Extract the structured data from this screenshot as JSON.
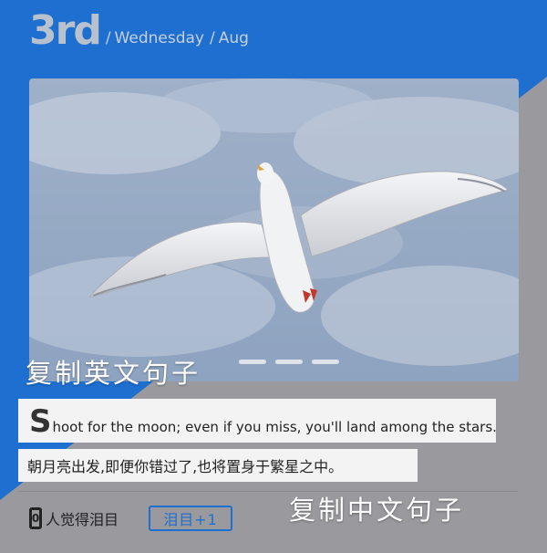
{
  "header": {
    "day": "3rd",
    "sep1": "/",
    "weekday": "Wednesday",
    "sep2": "/",
    "month": "Aug"
  },
  "photo": {
    "subject": "seagull-flying-cloudy-sky"
  },
  "carousel": {
    "page_count": 3
  },
  "overlays": {
    "copy_english": "复制英文句子",
    "copy_chinese": "复制中文句子"
  },
  "quote": {
    "en_first_letter": "S",
    "en_rest": "hoot for the moon; even if you miss, you'll land among the stars.",
    "zh": "朝月亮出发,即便你错过了,也将置身于繁星之中。"
  },
  "footer": {
    "like_count": "0",
    "like_label": "人觉得泪目",
    "tear_button": "泪目+1"
  },
  "colors": {
    "header_blue": "#1e6fd0",
    "gray_panel": "#9a9a9e",
    "accent": "#1e6fd0"
  }
}
